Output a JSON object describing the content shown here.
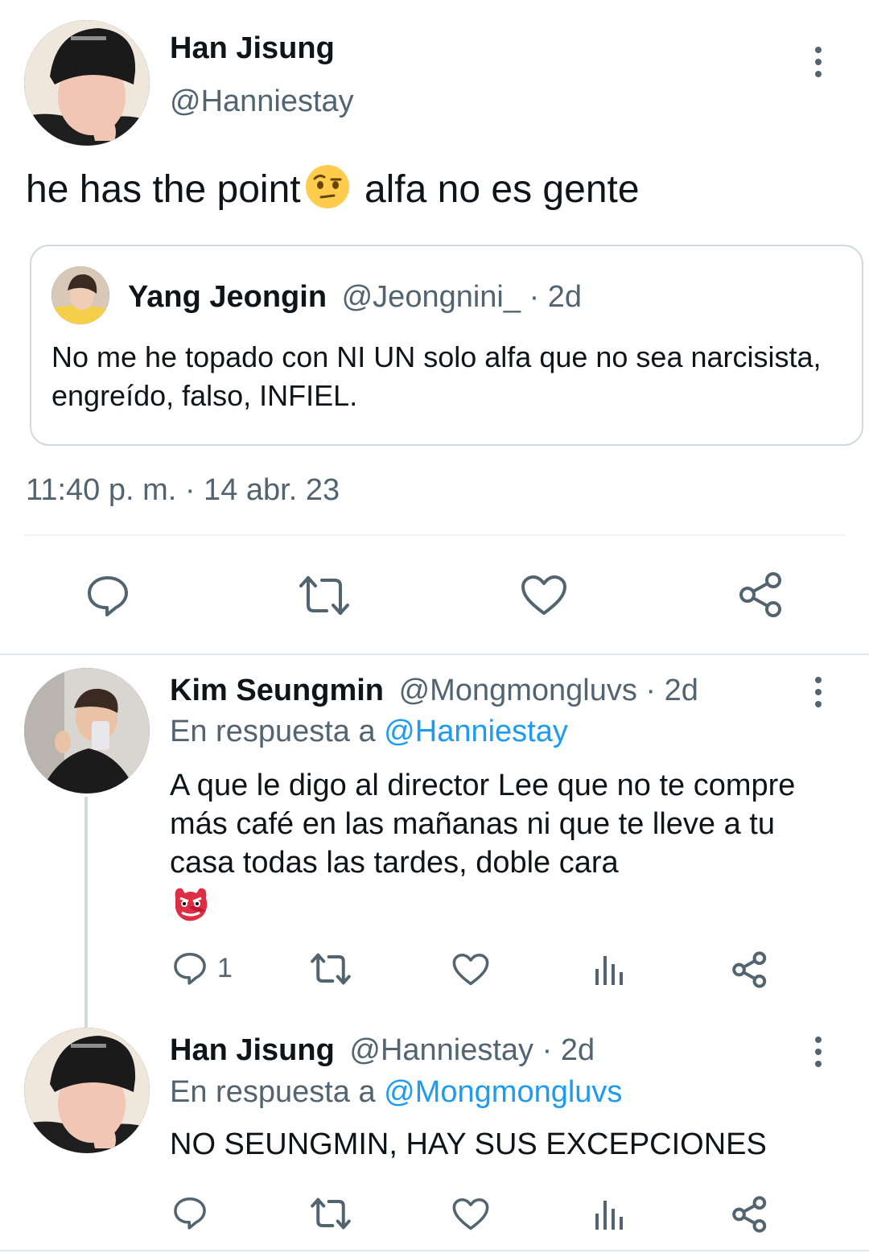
{
  "main_tweet": {
    "name": "Han Jisung",
    "handle": "@Hanniestay",
    "text_before": "he has the point",
    "text_after": " alfa no es gente",
    "emoji": "face-with-raised-eyebrow",
    "timestamp": "11:40 p. m. · 14 abr. 23",
    "quote": {
      "name": "Yang Jeongin",
      "handle": "@Jeongnini_",
      "time": "· 2d",
      "text": "No me he topado con NI UN solo alfa que no sea narcisista, engreído, falso, INFIEL."
    }
  },
  "replies": [
    {
      "name": "Kim Seungmin",
      "handle": "@Mongmongluvs",
      "time": "· 2d",
      "reply_prefix": "En respuesta a ",
      "reply_to": "@Hanniestay",
      "text": "A que le digo al director Lee que no te compre más café en las mañanas ni que te lleve a tu casa todas las tardes, doble cara",
      "emoji": "goblin",
      "reply_count": "1"
    },
    {
      "name": "Han Jisung",
      "handle": "@Hanniestay",
      "time": "· 2d",
      "reply_prefix": "En respuesta a ",
      "reply_to": "@Mongmongluvs",
      "text": "NO SEUNGMIN, HAY SUS EXCEPCIONES"
    }
  ],
  "icons": [
    "reply-icon",
    "retweet-icon",
    "like-icon",
    "share-icon",
    "analytics-icon",
    "more-icon"
  ],
  "colors": {
    "text": "#0f1419",
    "secondary": "#536471",
    "link": "#1d9bf0",
    "border": "#cfd9de"
  }
}
